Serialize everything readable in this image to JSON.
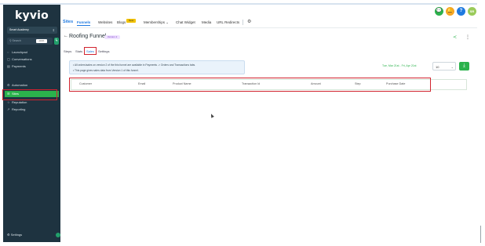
{
  "app": {
    "logo_text": "kyvio",
    "account_name": "Smart Academy",
    "search_placeholder": "Search",
    "search_shortcut": "ctrl K"
  },
  "sidebar": {
    "items": [
      {
        "label": "Launchpad",
        "icon": "rocket-icon",
        "glyph": "◌"
      },
      {
        "label": "Conversations",
        "icon": "chat-icon",
        "glyph": "▢"
      },
      {
        "label": "Payments",
        "icon": "payments-icon",
        "glyph": "▤"
      },
      {
        "label": "Automation",
        "icon": "automation-icon",
        "glyph": "⚙"
      },
      {
        "label": "Sites",
        "icon": "sites-icon",
        "glyph": "☰"
      },
      {
        "label": "Reputation",
        "icon": "star-icon",
        "glyph": "☆"
      },
      {
        "label": "Reporting",
        "icon": "chart-icon",
        "glyph": "↗"
      }
    ],
    "settings_label": "Settings"
  },
  "topnav": {
    "brand": "Sites",
    "items": [
      "Funnels",
      "Websites",
      "Blogs",
      "Memberships ⌄",
      "Chat Widget",
      "Media",
      "URL Redirects"
    ],
    "new_badge": "New"
  },
  "header_icons": [
    "💬",
    "🔔",
    "?",
    "SR"
  ],
  "header_icon_colors": [
    "#2bb24c",
    "#f5a623",
    "#1f7ae0",
    "#9acb5a"
  ],
  "page": {
    "back": "←",
    "title": "Roofing Funnel",
    "version_badge": "Version 2",
    "tabs": [
      "Steps",
      "Stats",
      "Sales",
      "Settings"
    ]
  },
  "info": {
    "line1": "• All orders/sales on version 2 of the this funnel are available in Payments -> Orders and Transactions tabs.",
    "line2": "• This page gives sales data from Version 1 of this funnel."
  },
  "filters": {
    "date_range": "Tue, Mar 21st - Fri, Apr 21st",
    "page_size": "10"
  },
  "table": {
    "columns": [
      "Customer",
      "Email",
      "Product Name",
      "Transaction Id",
      "Amount",
      "Step",
      "Purchase Date"
    ]
  }
}
